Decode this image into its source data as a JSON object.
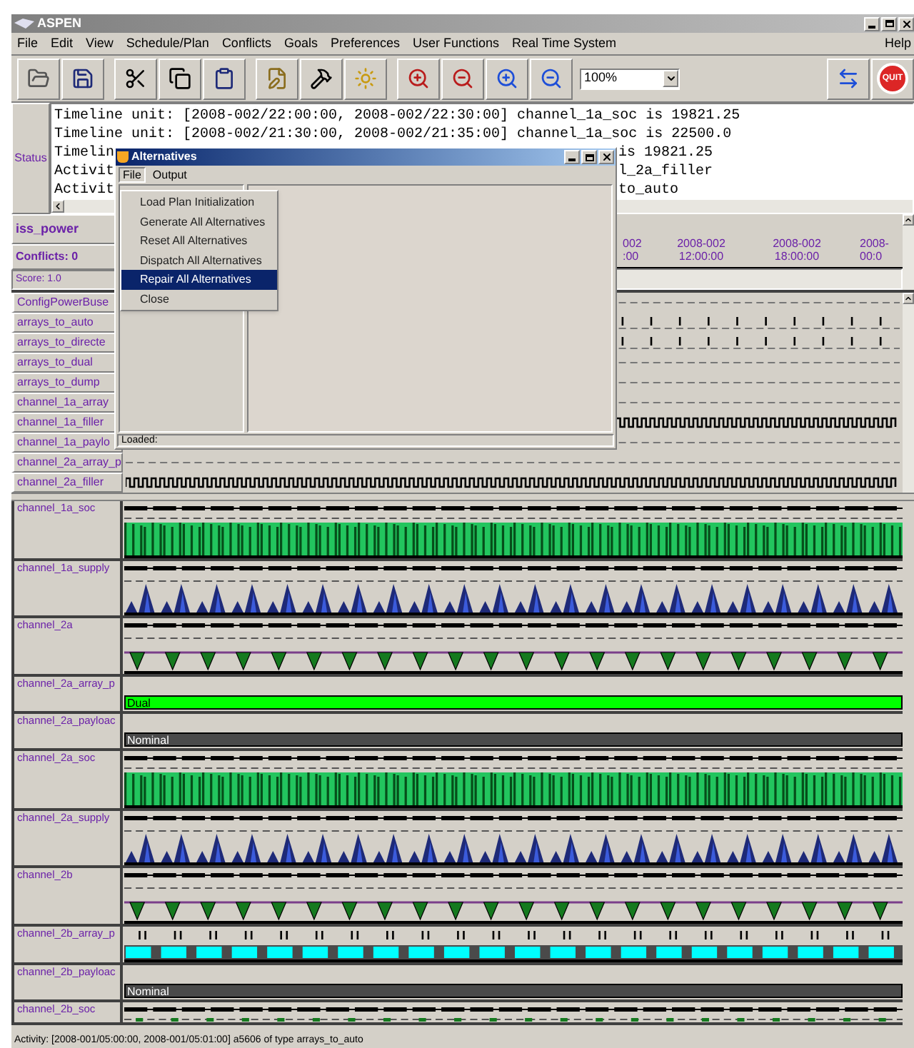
{
  "window": {
    "title": "ASPEN"
  },
  "menu": [
    "File",
    "Edit",
    "View",
    "Schedule/Plan",
    "Conflicts",
    "Goals",
    "Preferences",
    "User Functions",
    "Real Time System"
  ],
  "help_menu": "Help",
  "toolbar": {
    "zoom": "100%",
    "quit": "QUIT"
  },
  "status": {
    "label": "Status",
    "lines": [
      {
        "text": "Timeline unit: [2008-002/22:00:00, 2008-002/22:30:00] channel_1a_soc is 19821.25"
      },
      {
        "text": "Timeline unit: [2008-002/21:30:00, 2008-002/21:35:00] channel_1a_soc is 22500.0"
      },
      {
        "text": "Timelin",
        "tail": "is 19821.25"
      },
      {
        "text": "Activit",
        "tail": "l_2a_filler"
      },
      {
        "text": "Activit",
        "tail": "to_auto"
      }
    ]
  },
  "plan": {
    "name": "iss_power",
    "conflicts": "Conflicts: 0",
    "score": "Score: 1.0"
  },
  "time_axis": [
    {
      "date": "002",
      "time": ":00"
    },
    {
      "date": "2008-002",
      "time": "12:00:00"
    },
    {
      "date": "2008-002",
      "time": "18:00:00"
    },
    {
      "date": "2008-",
      "time": "00:0"
    }
  ],
  "activities": [
    {
      "label": "ConfigPowerBuse",
      "kind": "empty"
    },
    {
      "label": "arrays_to_auto",
      "kind": "ticks"
    },
    {
      "label": "arrays_to_directe",
      "kind": "ticks"
    },
    {
      "label": "arrays_to_dual",
      "kind": "empty"
    },
    {
      "label": "arrays_to_dump",
      "kind": "empty"
    },
    {
      "label": "channel_1a_array",
      "kind": "empty"
    },
    {
      "label": "channel_1a_filler",
      "kind": "square"
    },
    {
      "label": "channel_1a_paylo",
      "kind": "empty"
    },
    {
      "label": "channel_2a_array_p",
      "kind": "empty"
    },
    {
      "label": "channel_2a_filler",
      "kind": "square"
    }
  ],
  "resources": [
    {
      "label": "channel_1a_soc",
      "kind": "soc"
    },
    {
      "label": "channel_1a_supply",
      "kind": "supply"
    },
    {
      "label": "channel_2a",
      "kind": "power"
    },
    {
      "label": "channel_2a_array_p",
      "kind": "state",
      "state": "Dual",
      "color": "#00ff00"
    },
    {
      "label": "channel_2a_payloac",
      "kind": "state",
      "state": "Nominal",
      "color": "#4a4a4a"
    },
    {
      "label": "channel_2a_soc",
      "kind": "soc"
    },
    {
      "label": "channel_2a_supply",
      "kind": "supply"
    },
    {
      "label": "channel_2b",
      "kind": "power"
    },
    {
      "label": "channel_2b_array_p",
      "kind": "blocks"
    },
    {
      "label": "channel_2b_payloac",
      "kind": "state",
      "state": "Nominal",
      "color": "#4a4a4a"
    },
    {
      "label": "channel_2b_soc",
      "kind": "bead"
    }
  ],
  "status_bar": "Activity: [2008-001/05:00:00, 2008-001/05:01:00] a5606 of type arrays_to_auto",
  "dialog": {
    "title": "Alternatives",
    "menu": [
      {
        "label": "File",
        "selected": true
      },
      {
        "label": "Output",
        "selected": false
      }
    ],
    "items": [
      {
        "label": "Load Plan Initialization",
        "selected": false
      },
      {
        "label": "Generate All Alternatives",
        "selected": false
      },
      {
        "label": "Reset All Alternatives",
        "selected": false
      },
      {
        "label": "Dispatch All Alternatives",
        "selected": false
      },
      {
        "label": "Repair All Alternatives",
        "selected": true
      },
      {
        "label": "Close",
        "selected": false
      }
    ],
    "status": "Loaded:"
  }
}
